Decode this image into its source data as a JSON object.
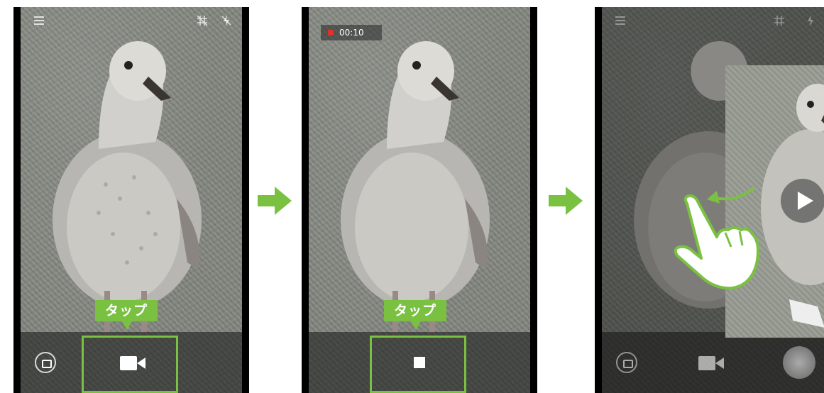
{
  "step1": {
    "tap_label": "タップ",
    "icons": [
      "menu-icon",
      "grid-off-icon",
      "flash-off-icon",
      "switch-camera-icon",
      "video-record-icon"
    ]
  },
  "step2": {
    "tap_label": "タップ",
    "timer": "00:10",
    "icons": [
      "record-dot-icon",
      "stop-icon"
    ]
  },
  "step3": {
    "icons": [
      "menu-icon",
      "grid-off-icon",
      "flash-off-icon",
      "play-icon",
      "swipe-hand-icon",
      "curved-arrow-icon",
      "switch-camera-icon",
      "video-icon",
      "gallery-thumbnail"
    ]
  },
  "colors": {
    "accent_green": "#7ac142",
    "record_red": "#e0312a"
  }
}
